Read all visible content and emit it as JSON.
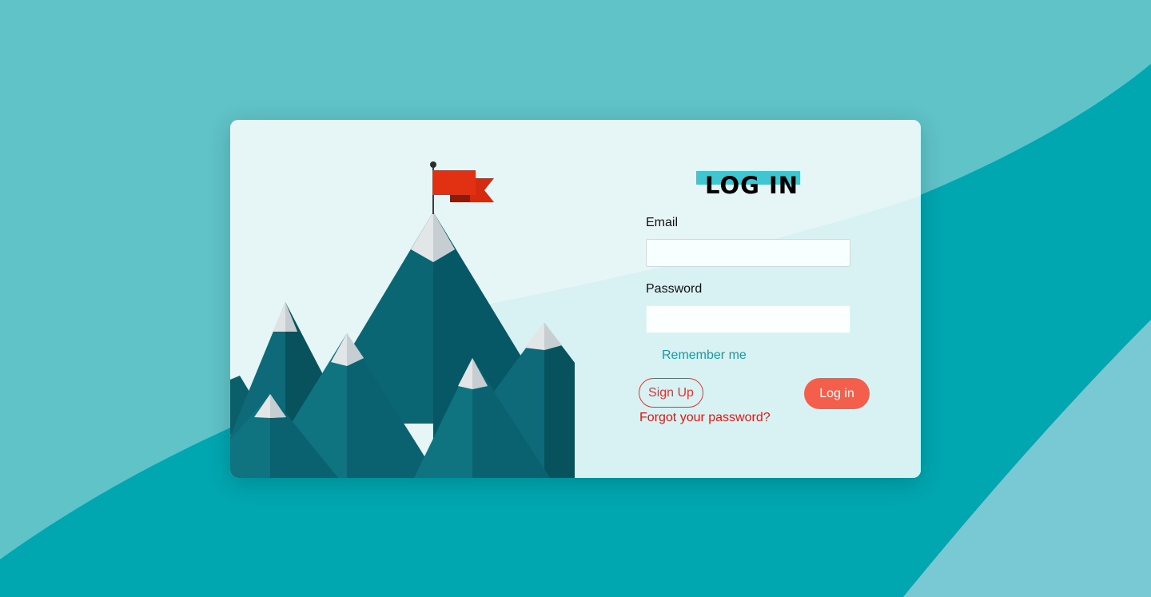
{
  "colors": {
    "page_background": "#5fc3c8",
    "wave_dark": "#00a6b0",
    "wave_light": "#79c9d4",
    "card_background": "#e6f6f7",
    "title_highlight": "#3fc6d0",
    "accent_red": "#e8322e",
    "login_button": "#f45f4b",
    "link_teal": "#1a9aa0"
  },
  "illustration": {
    "icon": "mountain-peak-flag-icon"
  },
  "login_form": {
    "title": "LOG IN",
    "email_label": "Email",
    "email_value": "",
    "password_label": "Password",
    "password_value": "",
    "remember_label": "Remember me",
    "signup_label": "Sign Up",
    "login_label": "Log in",
    "forgot_label": "Forgot your password?"
  }
}
